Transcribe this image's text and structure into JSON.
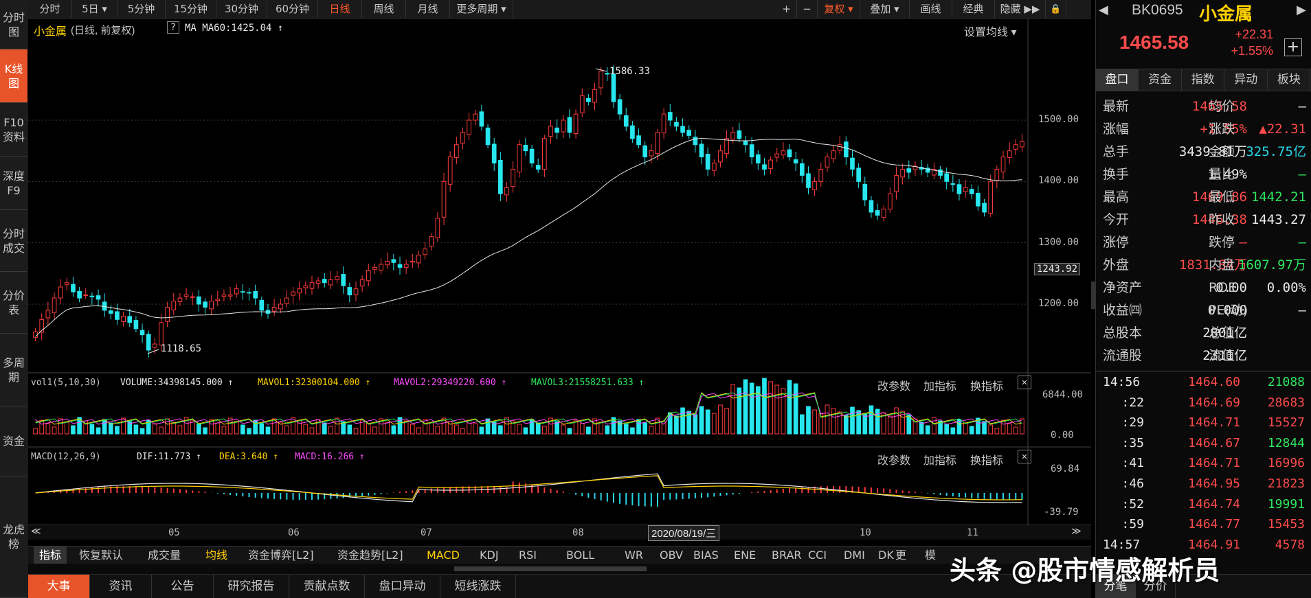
{
  "left_nav": [
    "分时图",
    "K线图",
    "F10资料",
    "深度F9",
    "分时成交",
    "分价表",
    "多周期",
    "资金",
    "龙虎榜"
  ],
  "top_bar": {
    "periods": [
      "分时",
      "5日",
      "5分钟",
      "15分钟",
      "30分钟",
      "60分钟",
      "日线",
      "周线",
      "月线",
      "更多周期"
    ],
    "active_period": "日线",
    "right_tools": [
      "+",
      "−",
      "复权",
      "叠加",
      "画线",
      "经典",
      "隐藏"
    ]
  },
  "chart_header": {
    "title": "小金属",
    "mode": "(日线, 前复权)",
    "help": "?",
    "ma_label": "MA  MA60:1425.04 ↑",
    "set_ma": "设置均线 ▾"
  },
  "vol_header": {
    "name": "vol1(5,10,30)",
    "volume": "VOLUME:34398145.000 ↑",
    "mavol1": "MAVOL1:32300104.000 ↑",
    "mavol2": "MAVOL2:29349220.600 ↑",
    "mavol3": "MAVOL3:21558251.633 ↑"
  },
  "macd_header": {
    "name": "MACD(12,26,9)",
    "dif": "DIF:11.773 ↑",
    "dea": "DEA:3.640 ↑",
    "macd": "MACD:16.266 ↑"
  },
  "pane_tools": [
    "改参数",
    "加指标",
    "换指标"
  ],
  "y_axis_price": [
    "1500.00",
    "1400.00",
    "1300.00",
    "1200.00"
  ],
  "y_axis_current": "1243.92",
  "y_axis_vol": [
    "6844.00",
    "0.00"
  ],
  "y_axis_macd": [
    "69.84",
    "-39.79"
  ],
  "x_axis_months": [
    "05",
    "06",
    "07",
    "08",
    "10",
    "11"
  ],
  "cursor_date": "2020/08/19/三",
  "annotations": {
    "high": "1586.33",
    "low": "1118.65"
  },
  "indicators": [
    "指标",
    "恢复默认",
    "成交量",
    "均线",
    "资金博弈[L2]",
    "资金趋势[L2]",
    "MACD",
    "KDJ",
    "RSI",
    "BOLL",
    "WR",
    "OBV",
    "BIAS",
    "ENE",
    "BRAR",
    "CCI",
    "DMI",
    "DK",
    "更",
    "模"
  ],
  "bottom_tabs": [
    "大事",
    "资讯",
    "公告",
    "研究报告",
    "贡献点数",
    "盘口异动",
    "短线涨跌"
  ],
  "quote": {
    "code": "BK0695",
    "name": "小金属",
    "price": "1465.58",
    "change": "+22.31",
    "change_pct": "+1.55%",
    "tabs": [
      "盘口",
      "资金",
      "指数",
      "异动",
      "板块"
    ],
    "rows": [
      [
        "最新",
        "1465.58",
        "red",
        "均价",
        "—",
        "white"
      ],
      [
        "涨幅",
        "+1.55%",
        "red",
        "涨跌",
        "▲22.31",
        "red"
      ],
      [
        "总手",
        "3439.81万",
        "white",
        "金额",
        "325.75亿",
        "cyan"
      ],
      [
        "换手",
        "1.49%",
        "white",
        "量比",
        "—",
        "green"
      ],
      [
        "最高",
        "1469.86",
        "red",
        "最低",
        "1442.21",
        "green"
      ],
      [
        "今开",
        "1446.38",
        "red",
        "昨收",
        "1443.27",
        "white"
      ],
      [
        "涨停",
        "—",
        "red",
        "跌停",
        "—",
        "green"
      ],
      [
        "外盘",
        "1831.84万",
        "red",
        "内盘",
        "1607.97万",
        "green"
      ],
      [
        "净资产",
        "0.00",
        "white",
        "ROE",
        "0.00%",
        "white"
      ],
      [
        "收益㈣",
        "0.000",
        "white",
        "PE(动)",
        "—",
        "white"
      ],
      [
        "总股本",
        "2801亿",
        "white",
        "总值",
        "",
        "white"
      ],
      [
        "流通股",
        "2311亿",
        "white",
        "流值",
        "",
        "white"
      ]
    ],
    "ticks": [
      [
        "14:56",
        "1464.60",
        "21088",
        "green"
      ],
      [
        ":22",
        "1464.69",
        "28683",
        "red"
      ],
      [
        ":29",
        "1464.71",
        "15527",
        "red"
      ],
      [
        ":35",
        "1464.67",
        "12844",
        "green"
      ],
      [
        ":41",
        "1464.71",
        "16996",
        "red"
      ],
      [
        ":46",
        "1464.95",
        "21823",
        "red"
      ],
      [
        ":52",
        "1464.74",
        "19991",
        "green"
      ],
      [
        ":59",
        "1464.77",
        "15453",
        "red"
      ],
      [
        "14:57",
        "1464.91",
        "4578",
        "red"
      ]
    ],
    "bottom_tabs": [
      "分笔",
      "分价"
    ]
  },
  "watermark": "头条 @股市情感解析员",
  "chart_data": {
    "type": "candlestick",
    "title": "小金属",
    "ylim": [
      1100,
      1620
    ],
    "months": [
      "05",
      "06",
      "07",
      "08",
      "10",
      "11"
    ],
    "closes": [
      1155,
      1175,
      1190,
      1210,
      1228,
      1235,
      1220,
      1210,
      1215,
      1212,
      1208,
      1190,
      1185,
      1175,
      1180,
      1170,
      1160,
      1150,
      1125,
      1135,
      1170,
      1195,
      1205,
      1210,
      1215,
      1212,
      1200,
      1195,
      1205,
      1208,
      1215,
      1215,
      1225,
      1220,
      1218,
      1210,
      1190,
      1185,
      1195,
      1200,
      1210,
      1220,
      1225,
      1230,
      1235,
      1238,
      1235,
      1240,
      1245,
      1230,
      1215,
      1225,
      1240,
      1255,
      1260,
      1265,
      1270,
      1268,
      1260,
      1265,
      1270,
      1280,
      1290,
      1310,
      1340,
      1400,
      1440,
      1460,
      1480,
      1500,
      1510,
      1490,
      1460,
      1430,
      1380,
      1390,
      1420,
      1460,
      1450,
      1430,
      1420,
      1470,
      1490,
      1480,
      1500,
      1480,
      1510,
      1540,
      1530,
      1550,
      1580,
      1575,
      1530,
      1510,
      1490,
      1470,
      1460,
      1440,
      1450,
      1480,
      1510,
      1500,
      1490,
      1480,
      1475,
      1460,
      1440,
      1420,
      1430,
      1450,
      1470,
      1480,
      1470,
      1460,
      1440,
      1430,
      1420,
      1435,
      1445,
      1450,
      1440,
      1430,
      1410,
      1390,
      1400,
      1420,
      1440,
      1450,
      1460,
      1440,
      1420,
      1400,
      1370,
      1350,
      1345,
      1355,
      1380,
      1410,
      1420,
      1415,
      1425,
      1420,
      1415,
      1420,
      1410,
      1400,
      1395,
      1380,
      1390,
      1380,
      1360,
      1350,
      1400,
      1420,
      1440,
      1450,
      1460,
      1465
    ]
  }
}
